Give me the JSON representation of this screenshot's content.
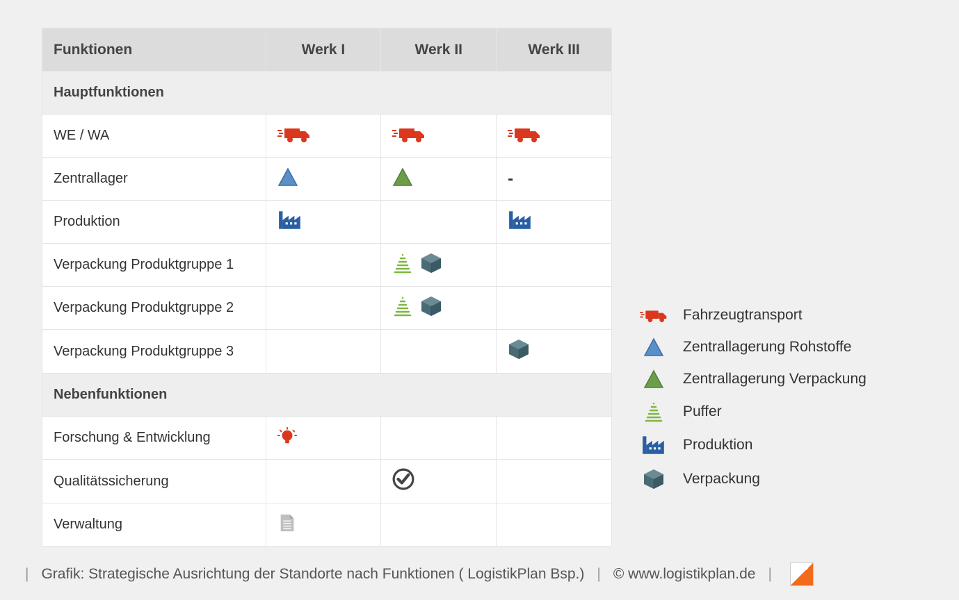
{
  "table": {
    "headers": {
      "functions": "Funktionen",
      "werk1": "Werk I",
      "werk2": "Werk II",
      "werk3": "Werk III"
    },
    "sections": [
      {
        "title": "Hauptfunktionen",
        "rows": [
          {
            "label": "WE / WA",
            "werk1": [
              "truck"
            ],
            "werk2": [
              "truck"
            ],
            "werk3": [
              "truck"
            ]
          },
          {
            "label": "Zentrallager",
            "werk1": [
              "triangle-blue"
            ],
            "werk2": [
              "triangle-green"
            ],
            "werk3": [
              "dash"
            ]
          },
          {
            "label": "Produktion",
            "werk1": [
              "factory"
            ],
            "werk2": [],
            "werk3": [
              "factory"
            ]
          },
          {
            "label": "Verpackung Produktgruppe 1",
            "werk1": [],
            "werk2": [
              "buffer",
              "box"
            ],
            "werk3": []
          },
          {
            "label": "Verpackung Produktgruppe 2",
            "werk1": [],
            "werk2": [
              "buffer",
              "box"
            ],
            "werk3": []
          },
          {
            "label": "Verpackung Produktgruppe 3",
            "werk1": [],
            "werk2": [],
            "werk3": [
              "box"
            ]
          }
        ]
      },
      {
        "title": "Nebenfunktionen",
        "rows": [
          {
            "label": "Forschung & Entwicklung",
            "werk1": [
              "lightbulb"
            ],
            "werk2": [],
            "werk3": []
          },
          {
            "label": "Qualitätssicherung",
            "werk1": [],
            "werk2": [
              "checkmark"
            ],
            "werk3": []
          },
          {
            "label": "Verwaltung",
            "werk1": [
              "document"
            ],
            "werk2": [],
            "werk3": []
          }
        ]
      }
    ]
  },
  "legend": [
    {
      "icon": "truck",
      "label": "Fahrzeugtransport"
    },
    {
      "icon": "triangle-blue",
      "label": "Zentrallagerung Rohstoffe"
    },
    {
      "icon": "triangle-green",
      "label": "Zentrallagerung Verpackung"
    },
    {
      "icon": "buffer",
      "label": "Puffer"
    },
    {
      "icon": "factory",
      "label": "Produktion"
    },
    {
      "icon": "box",
      "label": "Verpackung"
    }
  ],
  "footer": {
    "caption": "Grafik: Strategische Ausrichtung der Standorte nach Funktionen ( LogistikPlan Bsp.)",
    "credit": "© www.logistikplan.de"
  }
}
